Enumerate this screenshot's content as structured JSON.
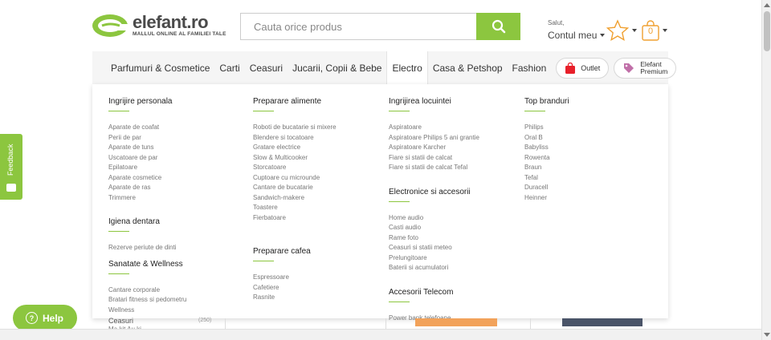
{
  "logo": {
    "name": "elefant.ro",
    "tagline": "MALLUL ONLINE AL FAMILIEI TALE"
  },
  "search": {
    "placeholder": "Cauta orice produs",
    "value": ""
  },
  "account": {
    "greeting": "Salut,",
    "label": "Contul meu"
  },
  "cart": {
    "count": "0"
  },
  "colors": {
    "brand_green": "#8cc63f",
    "outlet_red": "#e8202a",
    "premium_purple": "#c06fa8"
  },
  "icons": {
    "search": "search-icon",
    "favorites": "star-icon",
    "cart": "shopping-bag-icon",
    "outlet": "bag-icon",
    "premium": "tag-icon",
    "help": "question-icon",
    "feedback": "chat-icon"
  },
  "nav": {
    "items": [
      {
        "label": "Parfumuri & Cosmetice"
      },
      {
        "label": "Carti"
      },
      {
        "label": "Ceasuri"
      },
      {
        "label": "Jucarii, Copii & Bebe"
      },
      {
        "label": "Electro",
        "active": true
      },
      {
        "label": "Casa & Petshop"
      },
      {
        "label": "Fashion"
      }
    ],
    "outlet": "Outlet",
    "premium_line1": "Elefant",
    "premium_line2": "Premium"
  },
  "menu": {
    "columns": [
      {
        "sections": [
          {
            "title": "Ingrijire personala",
            "links": [
              "Aparate de coafat",
              "Perii de par",
              "Aparate de tuns",
              "Uscatoare de par",
              "Epilatoare",
              "Aparate cosmetice",
              "Aparate de ras",
              "Trimmere"
            ]
          },
          {
            "title": "Igiena dentara",
            "links": [
              "Rezerve periute de dinti"
            ]
          },
          {
            "title": "Sanatate & Wellness",
            "links": [
              "Cantare corporale",
              "Bratari fitness si pedometru",
              "Wellness"
            ]
          }
        ]
      },
      {
        "sections": [
          {
            "title": "Preparare alimente",
            "links": [
              "Roboti de bucatarie si mixere",
              "Blendere si tocatoare",
              "Gratare electrice",
              "Slow & Multicooker",
              "Storcatoare",
              "Cuptoare cu microunde",
              "Cantare de bucatarie",
              "Sandwich-makere",
              "Toastere",
              "Fierbatoare"
            ]
          },
          {
            "title": "Preparare cafea",
            "links": [
              "Espressoare",
              "Cafetiere",
              "Rasnite"
            ]
          }
        ]
      },
      {
        "sections": [
          {
            "title": "Ingrijirea locuintei",
            "links": [
              "Aspiratoare",
              "Aspiratoare Philips 5 ani grantie",
              "Aspiratoare Karcher",
              "Fiare si statii de calcat",
              "Fiare si statii de calcat Tefal"
            ]
          },
          {
            "title": "Electronice si accesorii",
            "links": [
              "Home audio",
              "Casti audio",
              "Rame foto",
              "Ceasuri si statii meteo",
              "Prelungitoare",
              "Baterii si acumulatori"
            ]
          },
          {
            "title": "Accesorii Telecom",
            "links": [
              "Power bank telefoane"
            ]
          }
        ]
      },
      {
        "sections": [
          {
            "title": "Top branduri",
            "links": [
              "Philips",
              "Oral B",
              "Babyliss",
              "Rowenta",
              "Braun",
              "Tefal",
              "Duracell",
              "Heinner"
            ]
          }
        ]
      }
    ]
  },
  "behind": {
    "category": "Ceasuri",
    "count": "(250)",
    "sub": "Ma kit Au ki"
  },
  "feedback": {
    "label": "Feedback"
  },
  "help": {
    "label": "Help"
  }
}
